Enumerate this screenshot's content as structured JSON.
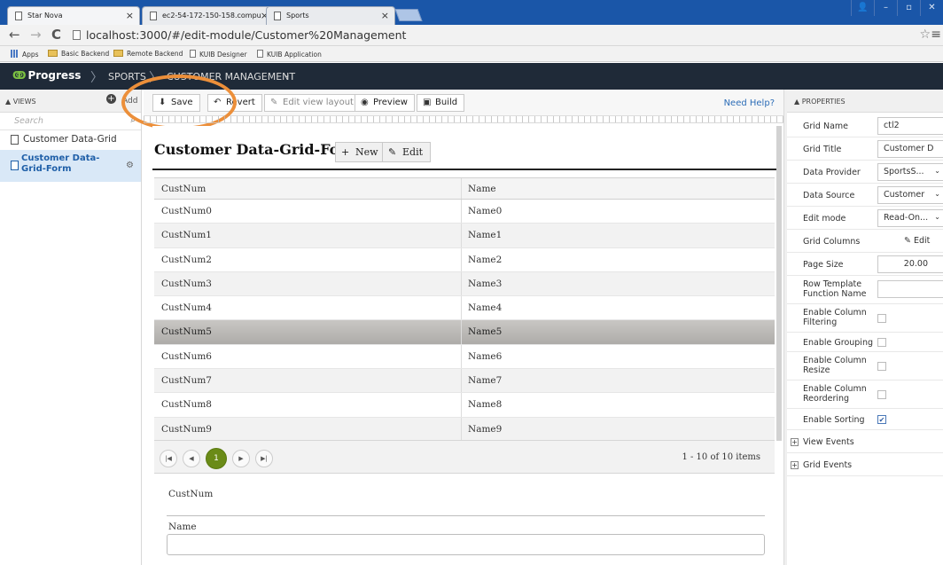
{
  "browser": {
    "tabs": [
      {
        "title": "Star Nova",
        "active": true
      },
      {
        "title": "ec2-54-172-150-158.compu",
        "active": false
      },
      {
        "title": "Sports",
        "active": false
      }
    ],
    "url": "localhost:3000/#/edit-module/Customer%20Management",
    "bookmarks": [
      "Apps",
      "Basic Backend",
      "Remote Backend",
      "KUIB Designer",
      "KUIB Application"
    ]
  },
  "app": {
    "logo": "Progress",
    "breadcrumb": [
      "SPORTS",
      "CUSTOMER MANAGEMENT"
    ]
  },
  "views_panel": {
    "title": "VIEWS",
    "add_label": "Add",
    "search_placeholder": "Search",
    "items": [
      {
        "label": "Customer Data-Grid",
        "selected": false
      },
      {
        "label": "Customer Data-Grid-Form",
        "selected": true
      }
    ]
  },
  "toolbar": {
    "save": "Save",
    "revert": "Revert",
    "edit_layout": "Edit view layout",
    "preview": "Preview",
    "build": "Build",
    "help": "Need Help?"
  },
  "form": {
    "title": "Customer Data-Grid-Form",
    "new_label": "New",
    "edit_label": "Edit",
    "columns": [
      "CustNum",
      "Name"
    ],
    "rows": [
      [
        "CustNum0",
        "Name0"
      ],
      [
        "CustNum1",
        "Name1"
      ],
      [
        "CustNum2",
        "Name2"
      ],
      [
        "CustNum3",
        "Name3"
      ],
      [
        "CustNum4",
        "Name4"
      ],
      [
        "CustNum5",
        "Name5"
      ],
      [
        "CustNum6",
        "Name6"
      ],
      [
        "CustNum7",
        "Name7"
      ],
      [
        "CustNum8",
        "Name8"
      ],
      [
        "CustNum9",
        "Name9"
      ]
    ],
    "selected_row": 5,
    "current_page": "1",
    "page_info": "1 - 10 of 10 items",
    "fields": [
      {
        "label": "CustNum",
        "value": ""
      },
      {
        "label": "Name",
        "value": ""
      }
    ]
  },
  "properties": {
    "title": "PROPERTIES",
    "grid_name_label": "Grid Name",
    "grid_name": "ctl2",
    "grid_title_label": "Grid Title",
    "grid_title": "Customer D",
    "data_provider_label": "Data Provider",
    "data_provider": "SportsS...",
    "data_source_label": "Data Source",
    "data_source": "Customer",
    "edit_mode_label": "Edit mode",
    "edit_mode": "Read-On...",
    "grid_columns_label": "Grid Columns",
    "grid_columns_edit": "Edit",
    "page_size_label": "Page Size",
    "page_size": "20.00",
    "row_template_label": "Row Template Function Name",
    "row_template": "",
    "filtering_label": "Enable Column Filtering",
    "filtering": false,
    "grouping_label": "Enable Grouping",
    "grouping": false,
    "resize_label": "Enable Column Resize",
    "resize": false,
    "reorder_label": "Enable Column Reordering",
    "reorder": false,
    "sorting_label": "Enable Sorting",
    "sorting": true,
    "view_events": "View Events",
    "grid_events": "Grid Events"
  },
  "colors": {
    "header_bg": "#1f2a38",
    "tabbar_bg": "#1a56a8",
    "highlight": "#ec8f3a",
    "pager_current": "#6a8b17",
    "selected_view": "#d9e8f7"
  }
}
